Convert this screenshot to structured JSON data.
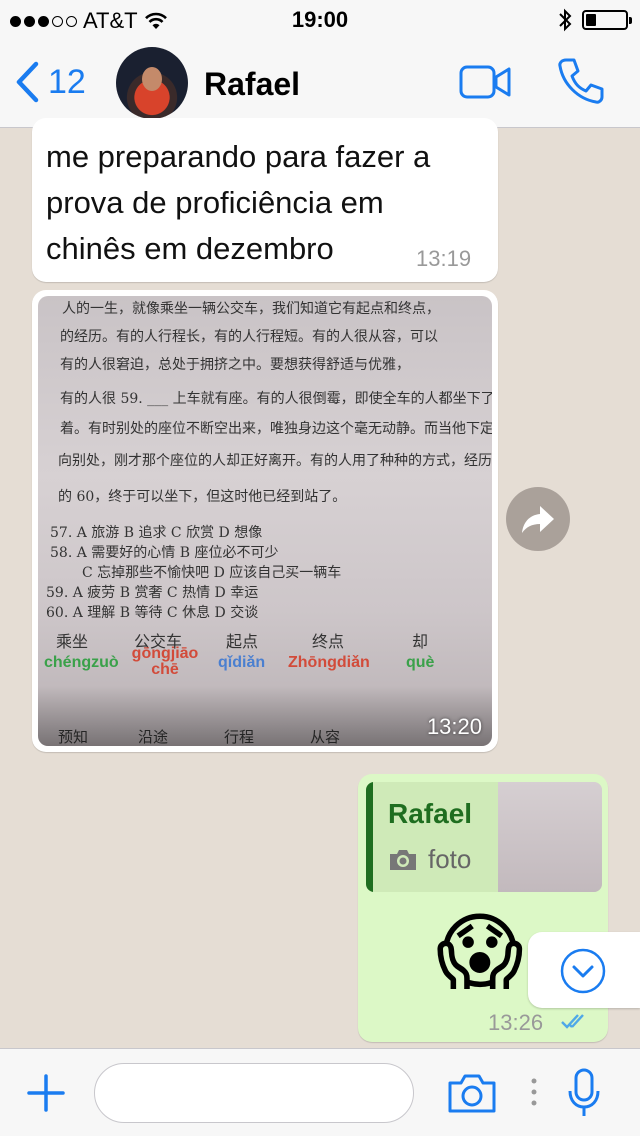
{
  "status_bar": {
    "carrier": "AT&T",
    "time": "19:00"
  },
  "header": {
    "back_count": "12",
    "contact_name": "Rafael",
    "icons": [
      "chevron-left-icon",
      "video-call-icon",
      "phone-icon"
    ]
  },
  "messages": [
    {
      "type": "incoming-text",
      "text_lines": [
        "me preparando para fazer a",
        "prova de proficiência em",
        "chinês em dezembro"
      ],
      "time": "13:19"
    },
    {
      "type": "incoming-photo",
      "time": "13:20",
      "photo_text": {
        "l1": "人的一生，就像乘坐一辆公交车，我们知道它有起点和终点，",
        "l2": "的经历。有的人行程长，有的人行程短。有的人很从容，可以",
        "l3": "有的人很窘迫，总处于拥挤之中。要想获得舒适与优雅，",
        "l4": "有的人很 59. ___ 上车就有座。有的人很倒霉，即使全车的人都坐下了，",
        "l5": "着。有时别处的座位不断空出来，唯独身边这个毫无动静。而当他下定",
        "l6": "向别处，刚才那个座位的人却正好离开。有的人用了种种的方式，经历",
        "l7": "的 60，终于可以坐下，但这时他已经到站了。",
        "q57": "57.  A 旅游  B 追求  C 欣赏  D 想像",
        "q58": "58.   A 需要好的心情  B 座位必不可少",
        "q58b": "C 忘掉那些不愉快吧  D 应该自己买一辆车",
        "q59": "59.  A 疲劳  B 赏奢  C 热情  D 幸运",
        "q60": "60.  A 理解  B 等待  C 休息  D 交谈",
        "vocab": [
          "乘坐",
          "公交车",
          "起点",
          "终点",
          "却"
        ],
        "pinyin": [
          "chéngzuò",
          "gōngjiāo chē",
          "qǐdiǎn",
          "Zhōngdiǎn",
          "què"
        ],
        "bottom": [
          "预知",
          "沿途",
          "行程",
          "从容"
        ]
      }
    },
    {
      "type": "outgoing-reply",
      "quote_name": "Rafael",
      "quote_type": "foto",
      "emoji": "😱",
      "time": "13:26",
      "status": "read"
    }
  ],
  "input": {
    "placeholder": ""
  }
}
